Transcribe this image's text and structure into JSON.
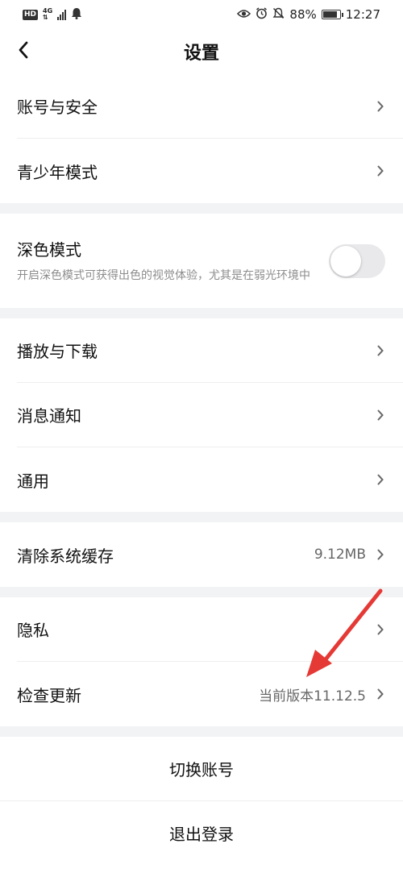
{
  "status_bar": {
    "hd": "HD",
    "network_top": "4G",
    "network_bottom": "⇅",
    "battery_percent": "88%",
    "battery_level": 0.88,
    "time": "12:27"
  },
  "header": {
    "title": "设置",
    "back_icon": "chevron-left-icon"
  },
  "groups": {
    "account": [
      {
        "label": "账号与安全",
        "icon": "chevron-right-icon"
      },
      {
        "label": "青少年模式",
        "icon": "chevron-right-icon"
      }
    ],
    "dark_mode": {
      "title": "深色模式",
      "description": "开启深色模式可获得出色的视觉体验，尤其是在弱光环境中",
      "enabled": false
    },
    "general": [
      {
        "label": "播放与下载"
      },
      {
        "label": "消息通知"
      },
      {
        "label": "通用"
      }
    ],
    "cache": {
      "label": "清除系统缓存",
      "value": "9.12MB"
    },
    "misc": [
      {
        "label": "隐私",
        "value": ""
      },
      {
        "label": "检查更新",
        "value": "当前版本11.12.5"
      }
    ]
  },
  "actions": {
    "switch_account": "切换账号",
    "logout": "退出登录"
  },
  "annotation": {
    "color": "#e53935",
    "icon": "red-arrow"
  }
}
